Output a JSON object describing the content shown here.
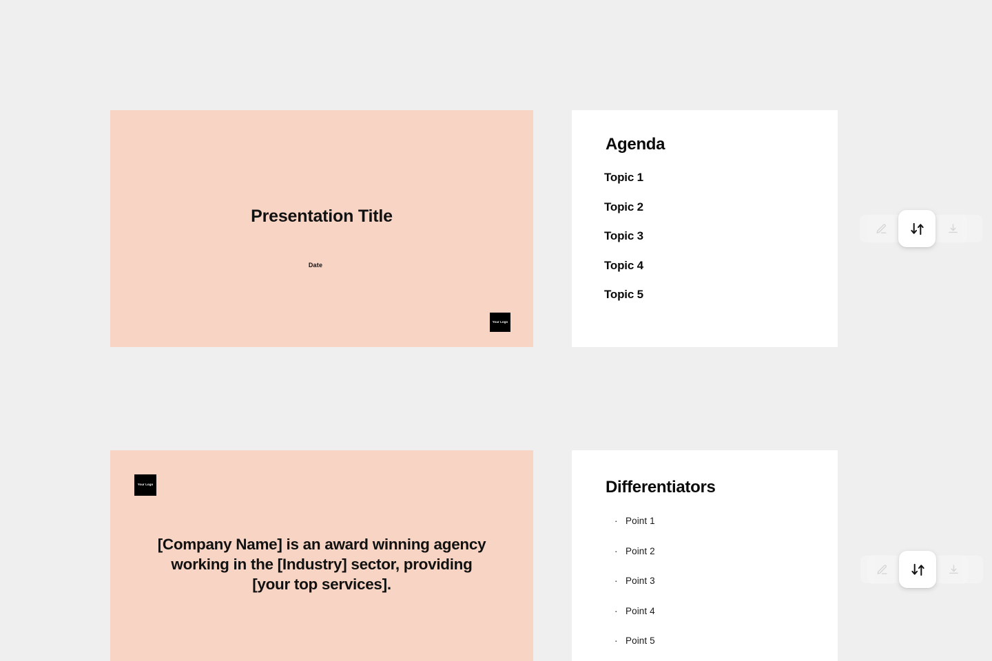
{
  "theme": {
    "page_background": "#efefef",
    "slide_pink": "#f8d4c4",
    "slide_white": "#ffffff",
    "text_color": "#111111",
    "logo_background": "#000000",
    "logo_text_color": "#ffffff"
  },
  "slides": [
    {
      "id": "title",
      "kind": "title",
      "background": "#f8d4c4",
      "title": "Presentation Title",
      "date": "Date",
      "logo": "Your Logo"
    },
    {
      "id": "agenda",
      "kind": "list",
      "background": "#ffffff",
      "heading": "Agenda",
      "items": [
        "Topic 1",
        "Topic 2",
        "Topic 3",
        "Topic 4",
        "Topic 5"
      ]
    },
    {
      "id": "company",
      "kind": "statement",
      "background": "#f8d4c4",
      "logo": "Your Logo",
      "statement": "[Company Name] is an award winning agency working in the [Industry] sector, providing [your top services]."
    },
    {
      "id": "differentiators",
      "kind": "bulleted-list",
      "background": "#ffffff",
      "heading": "Differentiators",
      "bullet": "·",
      "items": [
        "Point 1",
        "Point 2",
        "Point 3",
        "Point 4",
        "Point 5"
      ]
    }
  ],
  "toolbars": [
    {
      "id": "toolbar-top",
      "buttons": [
        {
          "icon": "edit-icon",
          "label": "",
          "state": "dimmed"
        },
        {
          "icon": "swap-vertical-icon",
          "label": "",
          "state": "active"
        },
        {
          "icon": "download-icon",
          "label": "",
          "state": "dimmed"
        }
      ]
    },
    {
      "id": "toolbar-bottom",
      "buttons": [
        {
          "icon": "edit-icon",
          "label": "",
          "state": "dimmed"
        },
        {
          "icon": "swap-vertical-icon",
          "label": "",
          "state": "active"
        },
        {
          "icon": "download-icon",
          "label": "",
          "state": "dimmed"
        }
      ]
    }
  ]
}
